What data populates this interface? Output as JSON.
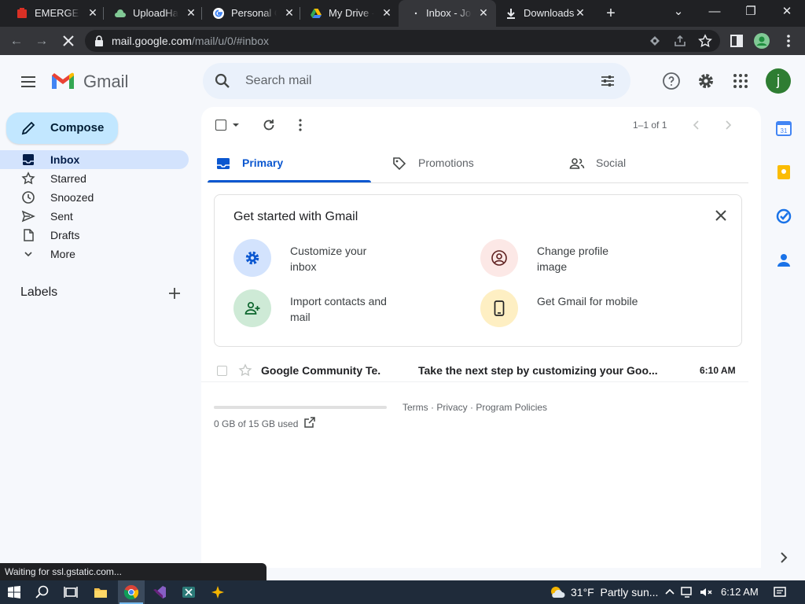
{
  "browser": {
    "tabs": [
      {
        "title": "EMERGENCY",
        "icon": "emergency-red-icon",
        "active": false
      },
      {
        "title": "UploadHaven",
        "icon": "uploadhaven-cloud-icon",
        "active": false
      },
      {
        "title": "Personal Cl",
        "icon": "google-g-icon",
        "active": false
      },
      {
        "title": "My Drive -",
        "icon": "google-drive-icon",
        "active": false
      },
      {
        "title": "Inbox - Joe",
        "icon": "loading-icon",
        "active": true
      },
      {
        "title": "Downloads",
        "icon": "download-icon",
        "active": false
      }
    ],
    "url_host": "mail.google.com",
    "url_path": "/mail/u/0/#inbox",
    "status_text": "Waiting for ssl.gstatic.com..."
  },
  "gmail": {
    "brand": "Gmail",
    "search_placeholder": "Search mail",
    "avatar_letter": "j",
    "compose_label": "Compose",
    "nav": [
      {
        "label": "Inbox",
        "icon": "inbox-icon",
        "active": true
      },
      {
        "label": "Starred",
        "icon": "star-icon",
        "active": false
      },
      {
        "label": "Snoozed",
        "icon": "clock-icon",
        "active": false
      },
      {
        "label": "Sent",
        "icon": "send-icon",
        "active": false
      },
      {
        "label": "Drafts",
        "icon": "draft-icon",
        "active": false
      },
      {
        "label": "More",
        "icon": "chevron-down-icon",
        "active": false
      }
    ],
    "labels_title": "Labels",
    "page_count": "1–1 of 1",
    "categories": [
      {
        "label": "Primary",
        "icon": "inbox-tray-icon",
        "active": true
      },
      {
        "label": "Promotions",
        "icon": "tag-icon",
        "active": false
      },
      {
        "label": "Social",
        "icon": "people-icon",
        "active": false
      }
    ],
    "get_started": {
      "title": "Get started with Gmail",
      "items": [
        {
          "label": "Customize your inbox",
          "icon": "gear-icon",
          "color": "#d3e3fd"
        },
        {
          "label": "Change profile image",
          "icon": "profile-icon",
          "color": "#fce8e6"
        },
        {
          "label": "Import contacts and mail",
          "icon": "add-person-icon",
          "color": "#ceead6"
        },
        {
          "label": "Get Gmail for mobile",
          "icon": "phone-icon",
          "color": "#feefc3"
        }
      ]
    },
    "emails": [
      {
        "sender": "Google Community Te.",
        "subject": "Take the next step by customizing your Goo...",
        "time": "6:10 AM",
        "unread": true
      }
    ],
    "storage_text": "0 GB of 15 GB used",
    "storage_fraction": 0.0,
    "footer_terms": "Terms",
    "footer_privacy": "Privacy",
    "footer_policies": "Program Policies",
    "accent_color": "#0b57d0"
  },
  "taskbar": {
    "temperature": "31°F",
    "weather": "Partly sun...",
    "time": "6:12 AM"
  }
}
